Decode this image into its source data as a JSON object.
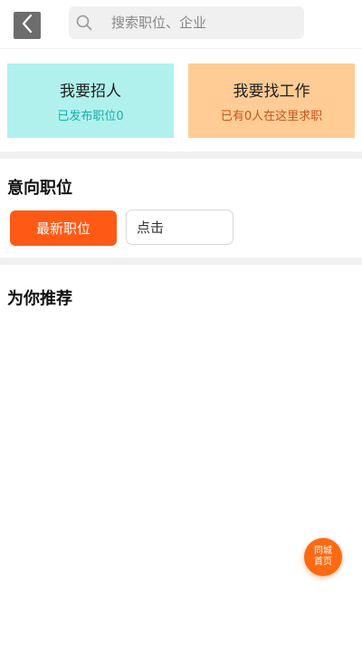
{
  "header": {
    "back_icon": "chevron-left-icon",
    "search": {
      "icon": "search-icon",
      "placeholder": "搜索职位、企业",
      "value": ""
    }
  },
  "cards": {
    "recruit": {
      "title": "我要招人",
      "subtitle": "已发布职位0"
    },
    "find_job": {
      "title": "我要找工作",
      "subtitle": "已有0人在这里求职"
    }
  },
  "intent": {
    "title": "意向职位",
    "latest_label": "最新职位",
    "click_label": "点击"
  },
  "recommend": {
    "title": "为你推荐"
  },
  "float_button": {
    "line1": "同城",
    "line2": "首页"
  },
  "colors": {
    "recruit_card_bg": "#b0f1ee",
    "recruit_sub": "#19aea6",
    "job_card_bg": "#ffcc95",
    "job_sub": "#c3561c",
    "accent": "#fe5a16"
  }
}
